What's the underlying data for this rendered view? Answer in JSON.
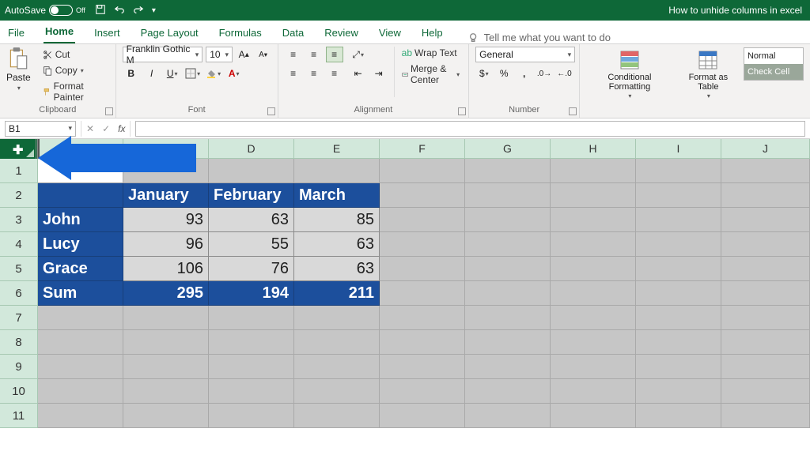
{
  "titlebar": {
    "autosave_label": "AutoSave",
    "autosave_state": "Off",
    "doc_title": "How to unhide columns in excel"
  },
  "tabs": {
    "file": "File",
    "home": "Home",
    "insert": "Insert",
    "pagelayout": "Page Layout",
    "formulas": "Formulas",
    "data": "Data",
    "review": "Review",
    "view": "View",
    "help": "Help",
    "tellme": "Tell me what you want to do"
  },
  "ribbon": {
    "clipboard": {
      "label": "Clipboard",
      "paste": "Paste",
      "cut": "Cut",
      "copy": "Copy",
      "format_painter": "Format Painter"
    },
    "font": {
      "label": "Font",
      "name": "Franklin Gothic M",
      "size": "10"
    },
    "alignment": {
      "label": "Alignment",
      "wrap": "Wrap Text",
      "merge": "Merge & Center"
    },
    "number": {
      "label": "Number",
      "format": "General"
    },
    "styles": {
      "cond": "Conditional Formatting",
      "table": "Format as Table",
      "normal": "Normal",
      "check": "Check Cell"
    }
  },
  "namebox": {
    "ref": "B1",
    "fx": "fx"
  },
  "columns": [
    "D",
    "E",
    "F",
    "G",
    "H",
    "I",
    "J"
  ],
  "row_numbers": [
    "1",
    "2",
    "3",
    "4",
    "5",
    "6",
    "7",
    "8",
    "9",
    "10",
    "11"
  ],
  "table": {
    "headers": [
      "January",
      "February",
      "March"
    ],
    "rows": [
      {
        "name": "John",
        "vals": [
          "93",
          "63",
          "85"
        ]
      },
      {
        "name": "Lucy",
        "vals": [
          "96",
          "55",
          "63"
        ]
      },
      {
        "name": "Grace",
        "vals": [
          "106",
          "76",
          "63"
        ]
      }
    ],
    "sum_label": "Sum",
    "sum_vals": [
      "295",
      "194",
      "211"
    ]
  },
  "chart_data": {
    "type": "table",
    "categories": [
      "January",
      "February",
      "March"
    ],
    "series": [
      {
        "name": "John",
        "values": [
          93,
          63,
          85
        ]
      },
      {
        "name": "Lucy",
        "values": [
          96,
          55,
          63
        ]
      },
      {
        "name": "Grace",
        "values": [
          106,
          76,
          63
        ]
      },
      {
        "name": "Sum",
        "values": [
          295,
          194,
          211
        ]
      }
    ],
    "title": "How to unhide columns in excel"
  }
}
